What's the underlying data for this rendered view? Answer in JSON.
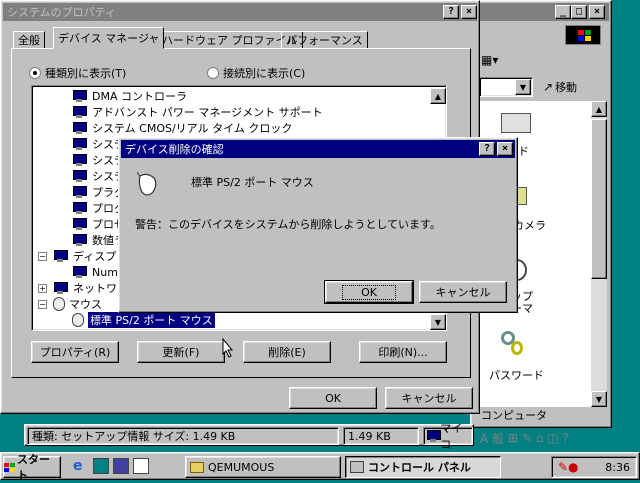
{
  "control_panel": {
    "go_button": "移動",
    "icons": {
      "keyboard": "キーボード",
      "camera": "スキャナとカメラ",
      "desktop_theme": "デスクトップ",
      "password": "パスワード"
    },
    "status_computer": "コンピュータ"
  },
  "sysprops": {
    "title": "システムのプロパティ",
    "tabs": [
      "全般",
      "デバイス マネージャ",
      "ハードウェア プロファイル",
      "パフォーマンス"
    ],
    "radio_by_type": "種類別に表示(T)",
    "radio_by_connection": "接続別に表示(C)",
    "tree": [
      {
        "label": "DMA コントローラ"
      },
      {
        "label": "アドバンスト パワー マネージメント サポート"
      },
      {
        "label": "システム CMOS/リアル タイム クロック"
      },
      {
        "label": "システム"
      },
      {
        "label": "システム"
      },
      {
        "label": "システム"
      },
      {
        "label": "プラグ"
      },
      {
        "label": "プログラ"
      },
      {
        "label": "プロセ"
      },
      {
        "label": "数値ラ"
      },
      {
        "label": "ディスプレイ"
      },
      {
        "label": "Numb"
      },
      {
        "label": "ネットワーク"
      },
      {
        "label": "マウス"
      },
      {
        "label": "標準 PS/2 ポート マウス"
      }
    ],
    "buttons": {
      "properties": "プロパティ(R)",
      "refresh": "更新(F)",
      "remove": "削除(E)",
      "print": "印刷(N)...",
      "ok": "OK",
      "cancel": "キャンセル"
    }
  },
  "dialog": {
    "title": "デバイス削除の確認",
    "device": "標準 PS/2 ポート マウス",
    "warning": "警告：このデバイスをシステムから削除しようとしています。",
    "ok": "OK",
    "cancel": "キャンセル"
  },
  "statusbar": {
    "info": "種類: セットアップ情報 サイズ: 1.49 KB",
    "size": "1.49 KB",
    "computer": "マイ コ"
  },
  "taskbar": {
    "start": "スタート",
    "task1": "QEMUMOUS",
    "task2": "コントロール パネル",
    "clock": "8:36"
  },
  "ime": {
    "label": "A 般"
  }
}
